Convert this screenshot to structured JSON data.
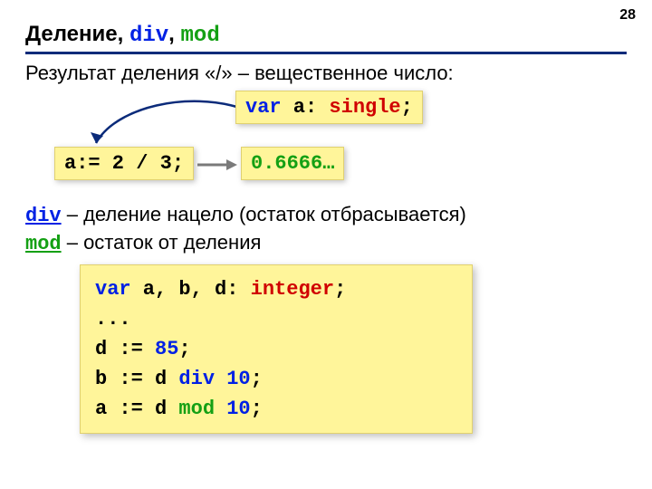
{
  "page_number": "28",
  "title": {
    "prefix": "Деление, ",
    "kw1": "div",
    "sep": ", ",
    "kw2": "mod"
  },
  "intro": "Результат деления «/» – вещественное число:",
  "single_box": {
    "t1": "var",
    "t2": " a: ",
    "t3": "single",
    "t4": ";"
  },
  "assign_box": "a:= 2 / 3;",
  "result_box": "0.6666…",
  "def_div": {
    "kw": "div",
    "text": " – деление нацело (остаток отбрасывается)"
  },
  "def_mod": {
    "kw": "mod",
    "text": " – остаток от деления"
  },
  "code": {
    "l1a": "var",
    "l1b": " a, b, d: ",
    "l1c": "integer",
    "l1d": ";",
    "l2": "...",
    "l3a": "d := ",
    "l3b": "85",
    "l3c": ";",
    "l4a": "b := d ",
    "l4b": "div",
    "l4c": " ",
    "l4d": "10",
    "l4e": ";",
    "l5a": "a := d ",
    "l5b": "mod",
    "l5c": " ",
    "l5d": "10",
    "l5e": ";"
  }
}
